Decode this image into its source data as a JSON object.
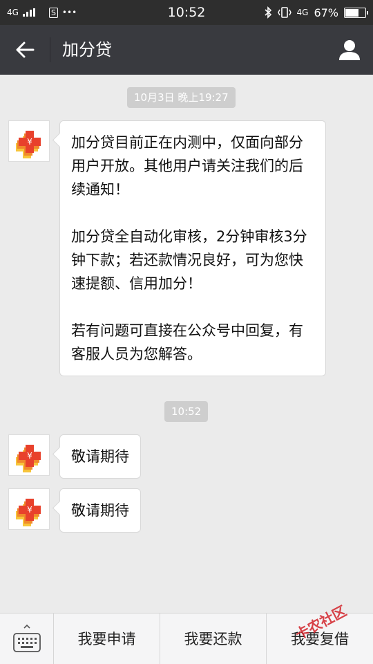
{
  "status_bar": {
    "network_1": "4G",
    "network_2": "4G",
    "s_badge": "S",
    "dots": "•••",
    "time": "10:52",
    "battery": "67%",
    "battery_level": 0.67,
    "icons": [
      "signal-icon",
      "bluetooth-icon",
      "vibrate-icon",
      "battery-icon"
    ]
  },
  "header": {
    "title": "加分贷",
    "icons": [
      "back-arrow-icon",
      "profile-icon"
    ]
  },
  "chat": {
    "timestamps": [
      "10月3日 晚上19:27",
      "10:52"
    ],
    "messages": [
      {
        "paragraphs": [
          "加分贷目前正在内测中，仅面向部分用户开放。其他用户请关注我们的后续通知！",
          "加分贷全自动化审核，2分钟审核3分钟下款；若还款情况良好，可为您快速提额、信用加分！",
          "若有问题可直接在公众号中回复，有客服人员为您解答。"
        ]
      },
      {
        "text": "敬请期待"
      },
      {
        "text": "敬请期待"
      }
    ]
  },
  "menu": {
    "items": [
      "我要申请",
      "我要还款",
      "我要复借"
    ],
    "icons": [
      "keyboard-icon"
    ]
  },
  "watermark": {
    "text": "卡农社区"
  },
  "colors": {
    "status_bar": "#2e2e2e",
    "title_bar": "#393a3f",
    "chat_bg": "#ebebeb",
    "bubble": "#ffffff",
    "logo_red": "#e8412c",
    "logo_yellow": "#f7c43a"
  }
}
